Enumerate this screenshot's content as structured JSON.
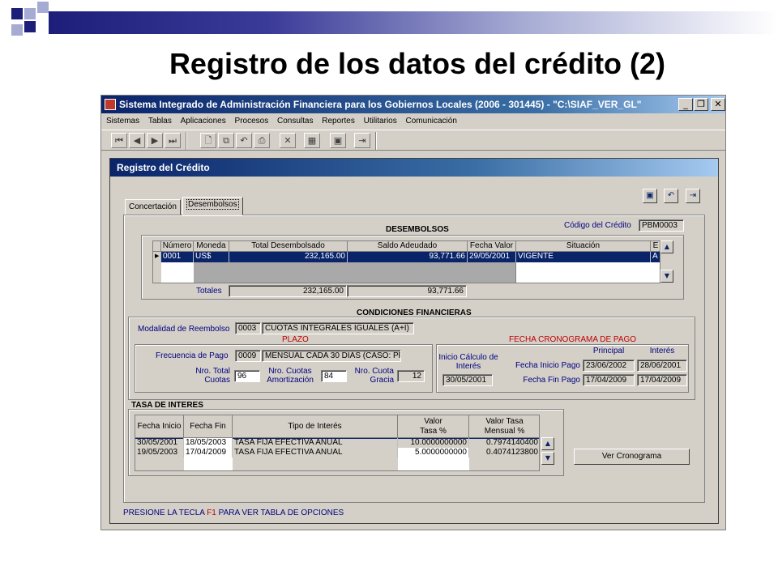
{
  "slide": {
    "title": "Registro de los datos del crédito (2)",
    "colors": {
      "dark": "#1d1d7a",
      "light": "#a6abd3"
    }
  },
  "app": {
    "title": "Sistema Integrado de Administración Financiera para los Gobiernos Locales (2006 - 301445) - \"C:\\SIAF_VER_GL\"",
    "menu": [
      "Sistemas",
      "Tablas",
      "Aplicaciones",
      "Procesos",
      "Consultas",
      "Reportes",
      "Utilitarios",
      "Comunicación"
    ],
    "toolbar_icons": [
      "first-record-icon",
      "prev-record-icon",
      "next-record-icon",
      "last-record-icon",
      "new-icon",
      "copy-icon",
      "undo-icon",
      "print-icon",
      "delete-icon",
      "database-icon",
      "save-icon",
      "exit-icon"
    ]
  },
  "dialog": {
    "title": "Registro del Crédito",
    "tabs": [
      "Concertación",
      "Desembolsos"
    ],
    "desembolsos": {
      "header": "DESEMBOLSOS",
      "codigo_label": "Código del Crédito",
      "codigo_value": "PBM0003",
      "columns": [
        "Número",
        "Moneda",
        "Total Desembolsado",
        "Saldo Adeudado",
        "Fecha Valor",
        "Situación",
        "E"
      ],
      "rows": [
        {
          "numero": "0001",
          "moneda": "US$",
          "total": "232,165.00",
          "saldo": "93,771.66",
          "fecha": "29/05/2001",
          "situacion": "VIGENTE",
          "e": "A"
        }
      ],
      "totales_label": "Totales",
      "total_desembolsado": "232,165.00",
      "total_saldo": "93,771.66"
    },
    "condiciones": {
      "header": "CONDICIONES FINANCIERAS",
      "modalidad_label": "Modalidad de Reembolso",
      "modalidad_code": "0003",
      "modalidad_desc": "CUOTAS INTEGRALES IGUALES (A+I)",
      "plazo_title": "PLAZO",
      "frecuencia_label": "Frecuencia de Pago",
      "frecuencia_code": "0009",
      "frecuencia_desc": "MENSUAL CADA 30 DIAS (CASO: PREBA",
      "nro_total_label_1": "Nro. Total",
      "nro_total_label_2": "Cuotas",
      "nro_total_value": "96",
      "nro_amort_label_1": "Nro. Cuotas",
      "nro_amort_label_2": "Amortización",
      "nro_amort_value": "84",
      "nro_gracia_label_1": "Nro. Cuota",
      "nro_gracia_label_2": "Gracia",
      "nro_gracia_value": "12",
      "cronograma_title": "FECHA CRONOGRAMA DE PAGO",
      "inicio_calculo_label_1": "Inicio Cálculo de",
      "inicio_calculo_label_2": "Interés",
      "inicio_calculo_value": "30/05/2001",
      "principal_header": "Principal",
      "interes_header": "Interés",
      "fecha_inicio_pago_label": "Fecha Inicio Pago",
      "fecha_inicio_principal": "23/06/2002",
      "fecha_inicio_interes": "28/06/2001",
      "fecha_fin_pago_label": "Fecha Fin Pago",
      "fecha_fin_principal": "17/04/2009",
      "fecha_fin_interes": "17/04/2009"
    },
    "tasa": {
      "header": "TASA DE INTERES",
      "columns": [
        "Fecha Inicio",
        "Fecha Fin",
        "Tipo de Interés",
        "Valor",
        "Tasa %",
        "Valor Tasa",
        "Mensual %"
      ],
      "rows": [
        {
          "inicio": "30/05/2001",
          "fin": "18/05/2003",
          "tipo": "TASA FIJA EFECTIVA ANUAL",
          "valor": "10.0000000000",
          "mensual": "0.7974140400"
        },
        {
          "inicio": "19/05/2003",
          "fin": "17/04/2009",
          "tipo": "TASA FIJA EFECTIVA ANUAL",
          "valor": "5.0000000000",
          "mensual": "0.4074123800"
        }
      ],
      "ver_cronograma": "Ver Cronograma"
    },
    "status": {
      "prefix": "PRESIONE LA TECLA",
      "key": "F1",
      "suffix": "PARA VER TABLA DE OPCIONES"
    }
  }
}
